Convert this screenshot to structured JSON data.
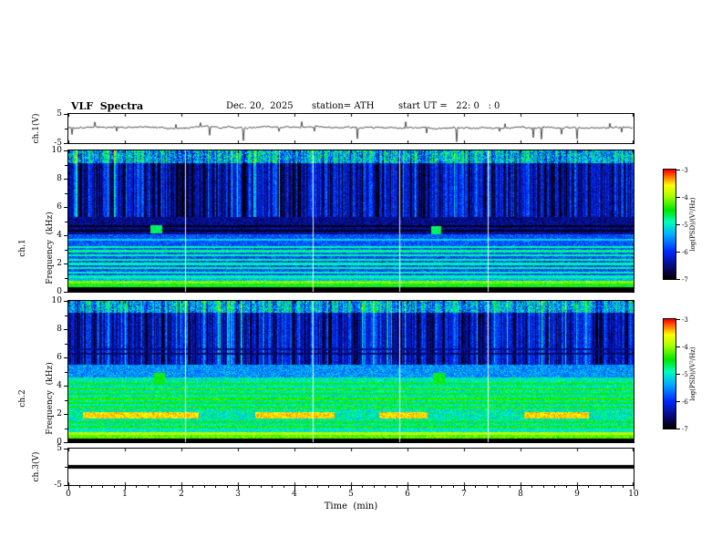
{
  "header": {
    "title": "VLF  Spectra",
    "date": "Dec. 20,  2025",
    "station": "station= ATH",
    "start_ut": "start UT =   22: 0   : 0"
  },
  "x_axis": {
    "label": "Time  (min)",
    "ticks": [
      0,
      1,
      2,
      3,
      4,
      5,
      6,
      7,
      8,
      9,
      10
    ],
    "range": [
      0,
      10
    ],
    "minor_per_major": 5
  },
  "colormap": [
    {
      "t": 0.0,
      "rgb": [
        0,
        0,
        0
      ]
    },
    {
      "t": 0.1,
      "rgb": [
        8,
        8,
        110
      ]
    },
    {
      "t": 0.25,
      "rgb": [
        0,
        40,
        255
      ]
    },
    {
      "t": 0.4,
      "rgb": [
        0,
        170,
        255
      ]
    },
    {
      "t": 0.52,
      "rgb": [
        0,
        255,
        190
      ]
    },
    {
      "t": 0.63,
      "rgb": [
        0,
        230,
        0
      ]
    },
    {
      "t": 0.76,
      "rgb": [
        170,
        255,
        0
      ]
    },
    {
      "t": 0.86,
      "rgb": [
        255,
        255,
        0
      ]
    },
    {
      "t": 0.93,
      "rgb": [
        255,
        130,
        0
      ]
    },
    {
      "t": 1.0,
      "rgb": [
        255,
        0,
        0
      ]
    }
  ],
  "dropouts_min": [
    2.06,
    4.33,
    5.86,
    7.42
  ],
  "chart_data": [
    {
      "type": "line",
      "name": "ch1_voltage_waveform",
      "ylabel": "ch.1(V)",
      "ylim": [
        -5,
        5
      ],
      "yticks": [
        5,
        -5
      ],
      "seed": 42,
      "signal": {
        "baseline": 0.2,
        "wander": 0.25,
        "noise": 0.5,
        "spike_rate": 0.03,
        "spike_neg_max": 4.5,
        "spike_pos_rate": 0.01,
        "spike_pos_max": 2.0
      }
    },
    {
      "type": "heatmap",
      "name": "ch1_spectrogram",
      "ylabel_line1": "ch.1",
      "ylabel_line2": "Frequency  (kHz)",
      "ylim": [
        0,
        10
      ],
      "yticks": [
        10,
        8,
        6,
        4,
        2,
        0
      ],
      "colorbar": {
        "label": "log(PSD)/(V²/Hz)",
        "ticks": [
          -3,
          -4,
          -5,
          -6,
          -7
        ],
        "min": -7,
        "max": -3
      },
      "seed": 101,
      "bands": [
        {
          "f": [
            0,
            0.35
          ],
          "level": -7.0,
          "noise": 0.05
        },
        {
          "f": [
            0.35,
            0.6
          ],
          "level": -4.5,
          "noise": 0.3
        },
        {
          "f": [
            0.6,
            0.8
          ],
          "level": -4.1,
          "noise": 0.25
        },
        {
          "f": [
            0.8,
            1.0
          ],
          "level": -5.3,
          "noise": 0.3
        },
        {
          "f": [
            1.0,
            3.4
          ],
          "level": -5.8,
          "noise": 0.4
        },
        {
          "f": [
            3.4,
            4.1
          ],
          "level": -5.8,
          "noise": 0.35
        },
        {
          "f": [
            4.1,
            5.3
          ],
          "level": -6.5,
          "noise": 0.3
        },
        {
          "f": [
            5.3,
            9.1
          ],
          "level": -6.1,
          "noise": 0.3,
          "streaks": true
        },
        {
          "f": [
            9.1,
            10.01
          ],
          "level": -5.1,
          "noise": 0.8,
          "streaks": true
        }
      ],
      "hlines": [
        {
          "f": 1.1,
          "level": -4.9
        },
        {
          "f": 1.4,
          "level": -4.9
        },
        {
          "f": 1.7,
          "level": -4.8
        },
        {
          "f": 2.0,
          "level": -4.9
        },
        {
          "f": 2.3,
          "level": -4.8
        },
        {
          "f": 2.6,
          "level": -4.9
        },
        {
          "f": 2.9,
          "level": -4.8
        },
        {
          "f": 3.2,
          "level": -4.9
        },
        {
          "f": 3.7,
          "level": -5.2
        },
        {
          "f": 4.35,
          "level": -6.9
        },
        {
          "f": 4.7,
          "level": -6.9
        }
      ],
      "blobs": [
        {
          "t": 1.55,
          "f": 4.45,
          "rt": 0.1,
          "rf": 0.3,
          "level": -4.7
        },
        {
          "t": 6.5,
          "f": 4.4,
          "rt": 0.09,
          "rf": 0.3,
          "level": -4.7
        }
      ],
      "streaks": {
        "dark_prob": 0.4,
        "bright_prob": 0.07
      }
    },
    {
      "type": "heatmap",
      "name": "ch2_spectrogram",
      "ylabel_line1": "ch.2",
      "ylabel_line2": "Frequency  (kHz)",
      "ylim": [
        0,
        10
      ],
      "yticks": [
        10,
        8,
        6,
        4,
        2,
        0
      ],
      "colorbar": {
        "label": "log(PSD)/(V²/Hz)",
        "ticks": [
          -3,
          -4,
          -5,
          -6,
          -7
        ],
        "min": -7,
        "max": -3
      },
      "seed": 202,
      "bands": [
        {
          "f": [
            0,
            0.3
          ],
          "level": -7.0,
          "noise": 0.05
        },
        {
          "f": [
            0.3,
            0.55
          ],
          "level": -4.2,
          "noise": 0.25
        },
        {
          "f": [
            0.55,
            0.75
          ],
          "level": -3.9,
          "noise": 0.2
        },
        {
          "f": [
            0.75,
            1.0
          ],
          "level": -5.0,
          "noise": 0.35
        },
        {
          "f": [
            1.0,
            4.6
          ],
          "level": -4.95,
          "noise": 0.45
        },
        {
          "f": [
            4.6,
            5.5
          ],
          "level": -5.5,
          "noise": 0.4
        },
        {
          "f": [
            5.5,
            9.2
          ],
          "level": -6.05,
          "noise": 0.3,
          "streaks": true
        },
        {
          "f": [
            9.2,
            10.01
          ],
          "level": -5.15,
          "noise": 0.7,
          "streaks": true
        }
      ],
      "hlines": [
        {
          "f": 1.15,
          "level": -4.4
        },
        {
          "f": 1.45,
          "level": -4.5
        },
        {
          "f": 2.5,
          "level": -4.4
        },
        {
          "f": 2.8,
          "level": -4.5
        },
        {
          "f": 3.1,
          "level": -4.4
        },
        {
          "f": 3.45,
          "level": -4.5
        },
        {
          "f": 3.8,
          "level": -4.4
        },
        {
          "f": 4.15,
          "level": -4.5
        },
        {
          "f": 6.3,
          "level": -6.6
        },
        {
          "f": 6.6,
          "level": -6.5
        }
      ],
      "segments": [
        {
          "f": [
            1.7,
            2.15
          ],
          "level": -3.5,
          "x": [
            [
              0.25,
              2.3
            ],
            [
              3.3,
              4.7
            ],
            [
              5.5,
              6.35
            ],
            [
              8.05,
              9.2
            ]
          ]
        }
      ],
      "blobs": [
        {
          "t": 1.6,
          "f": 4.6,
          "rt": 0.1,
          "rf": 0.35,
          "level": -4.5
        },
        {
          "t": 6.55,
          "f": 4.6,
          "rt": 0.1,
          "rf": 0.35,
          "level": -4.5
        }
      ],
      "streaks": {
        "dark_prob": 0.42,
        "bright_prob": 0.06
      }
    },
    {
      "type": "line",
      "name": "ch3_voltage_flatline",
      "ylabel": "ch.3(V)",
      "ylim": [
        -5,
        5
      ],
      "yticks": [
        5,
        -5
      ],
      "constant_value": 0,
      "line_width": 4
    }
  ]
}
